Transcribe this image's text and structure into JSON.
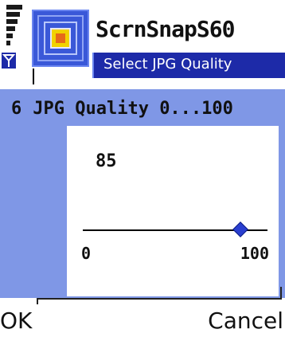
{
  "app": {
    "title": "ScrnSnapS60",
    "subtitle": "Select JPG Quality"
  },
  "dialog": {
    "index": "6",
    "label": "JPG Quality 0...100",
    "value": "85",
    "min_label": "0",
    "max_label": "100",
    "slider_fraction": 0.85
  },
  "softkeys": {
    "left": "OK",
    "right": "Cancel"
  },
  "colors": {
    "title_accent": "#1d2aa8",
    "dialog_background": "#7f97e6",
    "app_icon_blue": "#3a58d8",
    "slider_thumb": "#2a3fd0"
  },
  "icons": {
    "signal": "signal-strength-icon",
    "antenna": "antenna-icon",
    "app": "app-icon"
  }
}
